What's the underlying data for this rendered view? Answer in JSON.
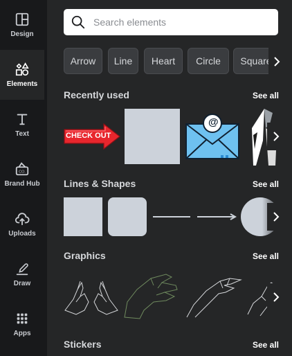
{
  "sidebar": {
    "items": [
      {
        "label": "Design",
        "icon": "layout-icon"
      },
      {
        "label": "Elements",
        "icon": "shapes-icon",
        "active": true
      },
      {
        "label": "Text",
        "icon": "text-icon"
      },
      {
        "label": "Brand Hub",
        "icon": "brand-hub-icon"
      },
      {
        "label": "Uploads",
        "icon": "upload-icon"
      },
      {
        "label": "Draw",
        "icon": "draw-icon"
      },
      {
        "label": "Apps",
        "icon": "apps-grid-icon"
      }
    ]
  },
  "search": {
    "placeholder": "Search elements"
  },
  "chips": [
    "Arrow",
    "Line",
    "Heart",
    "Circle",
    "Square"
  ],
  "sections": {
    "recently_used": {
      "title": "Recently used",
      "see_all": "See all",
      "checkout_text": "CHECK OUT",
      "mail_symbol": "@"
    },
    "lines_shapes": {
      "title": "Lines & Shapes",
      "see_all": "See all"
    },
    "graphics": {
      "title": "Graphics",
      "see_all": "See all"
    },
    "stickers": {
      "title": "Stickers",
      "see_all": "See all"
    }
  },
  "colors": {
    "rail_bg": "#18191b",
    "panel_bg": "#252627",
    "shape_fill": "#ccd2da",
    "checkout_red": "#e8262d",
    "envelope_blue": "#6ec1f0"
  }
}
